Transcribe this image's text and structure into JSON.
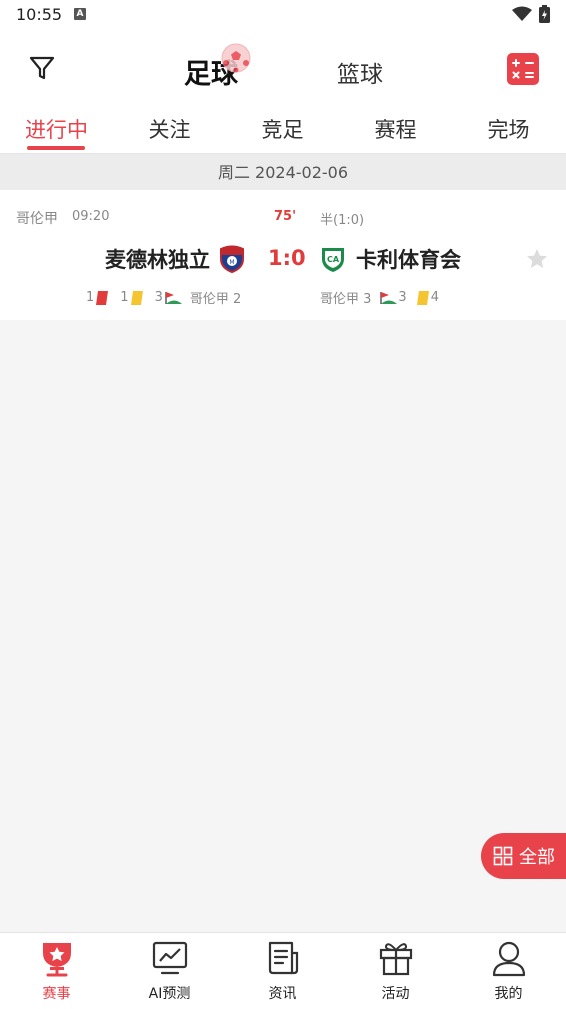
{
  "status_bar": {
    "time": "10:55",
    "notif_icon_letter": "A"
  },
  "header": {
    "sport_tabs": [
      {
        "label": "足球",
        "active": true
      },
      {
        "label": "篮球",
        "active": false
      }
    ],
    "filter_icon": "filter-icon",
    "calculator_icon": "calculator-icon"
  },
  "tabs": [
    {
      "label": "进行中",
      "active": true
    },
    {
      "label": "关注",
      "active": false
    },
    {
      "label": "竞足",
      "active": false
    },
    {
      "label": "赛程",
      "active": false
    },
    {
      "label": "完场",
      "active": false
    }
  ],
  "date_bar": {
    "text": "周二 2024-02-06"
  },
  "match": {
    "league": "哥伦甲",
    "kickoff": "09:20",
    "minute": "75'",
    "halftime": "半(1:0)",
    "home": {
      "name": "麦德林独立",
      "red_cards": "1",
      "yellow_cards": "1",
      "corners": "3",
      "rank_label": "哥伦甲 2"
    },
    "score": "1:0",
    "away": {
      "name": "卡利体育会",
      "rank_label": "哥伦甲 3",
      "corners": "3",
      "yellow_cards": "4"
    }
  },
  "fab": {
    "label": "全部"
  },
  "bottom_nav": [
    {
      "label": "赛事",
      "icon": "trophy-icon",
      "active": true
    },
    {
      "label": "AI预测",
      "icon": "chart-icon",
      "active": false
    },
    {
      "label": "资讯",
      "icon": "news-icon",
      "active": false
    },
    {
      "label": "活动",
      "icon": "gift-icon",
      "active": false
    },
    {
      "label": "我的",
      "icon": "user-icon",
      "active": false
    }
  ],
  "colors": {
    "accent": "#e8434b",
    "score": "#e23b3b",
    "yellow_card": "#f4c531"
  }
}
